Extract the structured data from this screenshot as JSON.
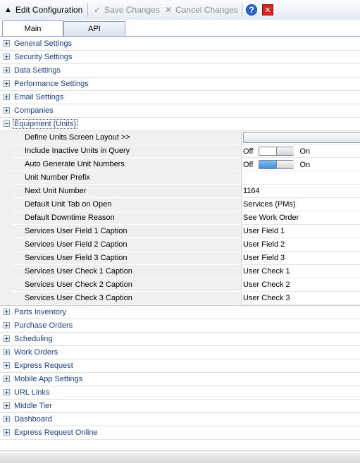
{
  "toolbar": {
    "title": "Edit Configuration",
    "save_label": "Save Changes",
    "cancel_label": "Cancel Changes",
    "help_glyph": "?",
    "close_glyph": "✕",
    "arrow_glyph": "▲",
    "save_glyph": "✓",
    "cancel_glyph": "✕"
  },
  "tabs": [
    {
      "label": "Main",
      "active": true
    },
    {
      "label": "API",
      "active": false
    }
  ],
  "categories_before": [
    {
      "label": "General Settings"
    },
    {
      "label": "Security Settings"
    },
    {
      "label": "Data Settings"
    },
    {
      "label": "Performance Settings"
    },
    {
      "label": "Email Settings"
    },
    {
      "label": "Companies"
    }
  ],
  "expanded_category": {
    "label": "Equipment (Units)",
    "properties": [
      {
        "name": "Define Units Screen Layout >>",
        "value": "",
        "kind": "button"
      },
      {
        "name": "Include Inactive Units in Query",
        "kind": "toggle",
        "off_label": "Off",
        "on_label": "On",
        "state": "off"
      },
      {
        "name": "Auto Generate Unit Numbers",
        "kind": "toggle",
        "off_label": "Off",
        "on_label": "On",
        "state": "on"
      },
      {
        "name": "Unit Number Prefix",
        "value": "",
        "kind": "text"
      },
      {
        "name": "Next Unit Number",
        "value": "1164",
        "kind": "text"
      },
      {
        "name": "Default Unit Tab on Open",
        "value": "Services (PMs)",
        "kind": "text"
      },
      {
        "name": "Default Downtime Reason",
        "value": "See Work Order",
        "kind": "text"
      },
      {
        "name": "Services User Field 1 Caption",
        "value": "User Field 1",
        "kind": "text"
      },
      {
        "name": "Services User Field 2 Caption",
        "value": "User Field 2",
        "kind": "text"
      },
      {
        "name": "Services User Field 3 Caption",
        "value": "User Field 3",
        "kind": "text"
      },
      {
        "name": "Services User Check 1 Caption",
        "value": "User Check 1",
        "kind": "text"
      },
      {
        "name": "Services User Check 2 Caption",
        "value": "User Check 2",
        "kind": "text"
      },
      {
        "name": "Services User Check 3 Caption",
        "value": "User Check 3",
        "kind": "text"
      }
    ]
  },
  "categories_after": [
    {
      "label": "Parts Inventory"
    },
    {
      "label": "Purchase Orders"
    },
    {
      "label": "Scheduling"
    },
    {
      "label": "Work Orders"
    },
    {
      "label": "Express Request"
    },
    {
      "label": "Mobile App Settings"
    },
    {
      "label": "URL Links"
    },
    {
      "label": "Middle Tier"
    },
    {
      "label": "Dashboard"
    },
    {
      "label": "Express Request Online"
    }
  ],
  "colors": {
    "category_text": "#1b3f8c",
    "toggle_on": "#3f91d8",
    "toolbar_bg": "#e6ebf3"
  }
}
